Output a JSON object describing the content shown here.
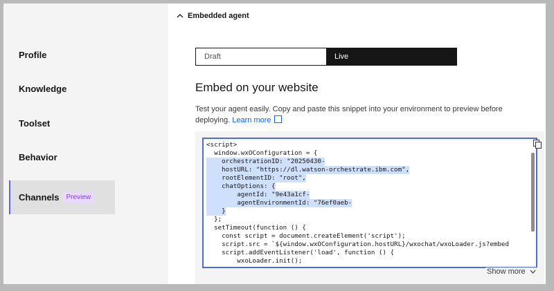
{
  "sidebar": {
    "items": [
      {
        "label": "Profile"
      },
      {
        "label": "Knowledge"
      },
      {
        "label": "Toolset"
      },
      {
        "label": "Behavior"
      },
      {
        "label": "Channels",
        "badge": "Preview",
        "active": true
      }
    ]
  },
  "section": {
    "title": "Embedded agent",
    "icon": "chevron-up-icon"
  },
  "environment_toggle": {
    "options": [
      "Draft",
      "Live"
    ],
    "selected": "Live"
  },
  "embed": {
    "title": "Embed on your website",
    "description": "Test your agent easily. Copy and paste this snippet into your environment to preview before deploying.",
    "learn_more": "Learn more",
    "show_more": "Show more",
    "code_lines": [
      "<script>",
      "  window.wxOConfiguration = {",
      "    orchestrationID: \"20250430-",
      "    hostURL: \"https://dl.watson-orchestrate.ibm.com\",",
      "    rootElementID: \"root\",",
      "    chatOptions: {",
      "        agentId: \"9e43a1cf-",
      "        agentEnvironmentId: \"76ef0aeb-",
      "    }",
      "  };",
      "  setTimeout(function () {",
      "    const script = document.createElement('script');",
      "    script.src = `${window.wxOConfiguration.hostURL}/wxochat/wxoLoader.js?embed",
      "    script.addEventListener('load', function () {",
      "        wxoLoader.init();"
    ]
  },
  "colors": {
    "accent": "#0f62fe",
    "selection": "#cfe0fb",
    "badge_text": "#8a3ffc"
  }
}
